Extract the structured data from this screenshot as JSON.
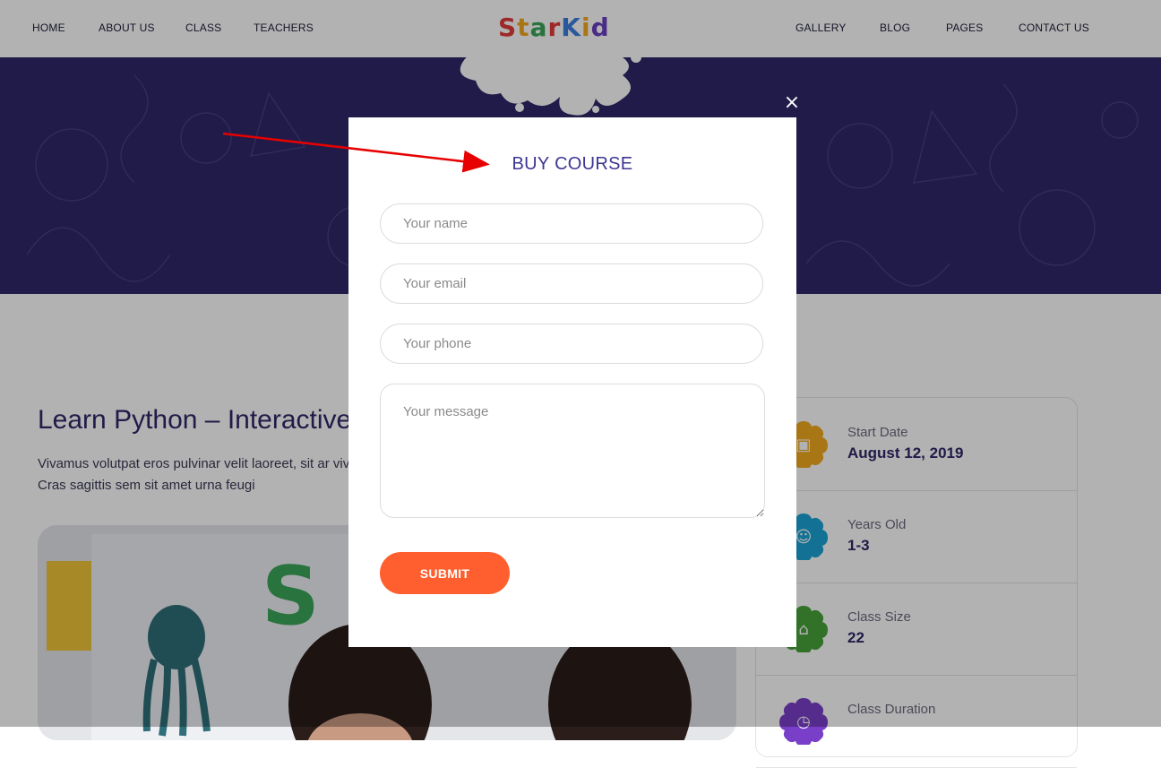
{
  "nav": {
    "home": "HOME",
    "about": "ABOUT US",
    "class": "CLASS",
    "teachers": "TEACHERS",
    "gallery": "GALLERY",
    "blog": "BLOG",
    "pages": "PAGES",
    "contact": "CONTACT US"
  },
  "logo": {
    "letters": [
      "S",
      "t",
      "a",
      "r",
      "K",
      "i",
      "d"
    ],
    "colors": [
      "#e23b3b",
      "#f2a91f",
      "#3aa55a",
      "#e23b3b",
      "#3d7ee0",
      "#f2a91f",
      "#6a3fc0"
    ]
  },
  "course": {
    "title": "Learn Python – Interactive",
    "description": "Vivamus volutpat eros pulvinar velit laoreet, sit ar viverra felis. Cras sagittis sem sit amet urna feugi"
  },
  "info": {
    "items": [
      {
        "label": "Start Date",
        "value": "August 12, 2019",
        "icon": "calendar-icon",
        "color": "#f2a91f"
      },
      {
        "label": "Years Old",
        "value": "1-3",
        "icon": "child-icon",
        "color": "#1ba3d4"
      },
      {
        "label": "Class Size",
        "value": "22",
        "icon": "home-icon",
        "color": "#47a23a"
      },
      {
        "label": "Class Duration",
        "value": "",
        "icon": "clock-icon",
        "color": "#7a3fc9"
      }
    ]
  },
  "modal": {
    "title": "BUY COURSE",
    "close": "×",
    "name_placeholder": "Your name",
    "email_placeholder": "Your email",
    "phone_placeholder": "Your phone",
    "message_placeholder": "Your message",
    "submit_label": "SUBMIT"
  },
  "colors": {
    "hero": "#2e2867",
    "accent": "#ff5f2e",
    "title": "#3d3694",
    "annotation_arrow": "#e60000"
  }
}
